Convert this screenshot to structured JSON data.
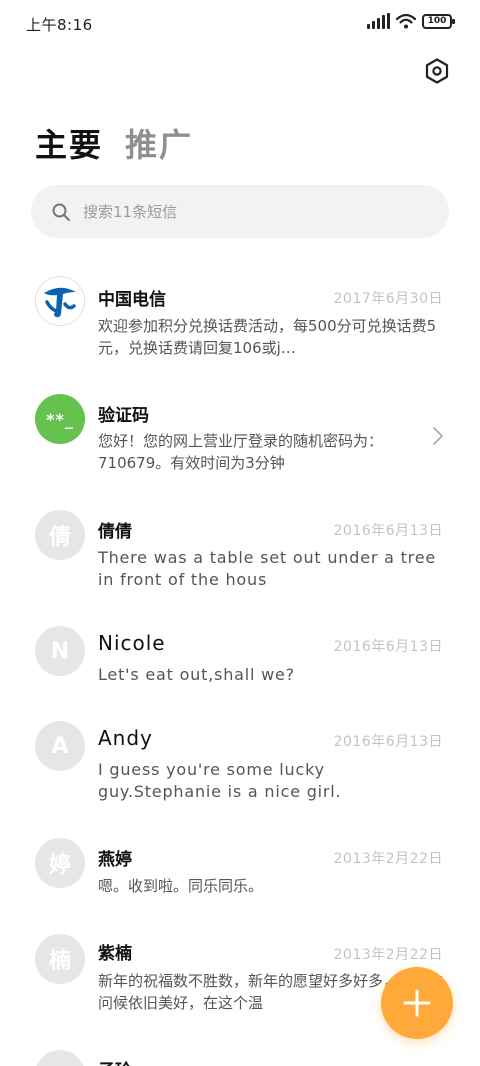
{
  "status_bar": {
    "time": "上午8:16",
    "battery": "100"
  },
  "tabs": {
    "primary": "主要",
    "secondary": "推广"
  },
  "search": {
    "placeholder": "搜索11条短信"
  },
  "messages": [
    {
      "avatar": "",
      "name": "中国电信",
      "date": "2017年6月30日",
      "preview": "欢迎参加积分兑换话费活动，每500分可兑换话费5元，兑换话费请回复106或j…"
    },
    {
      "avatar": "**_",
      "name": "验证码",
      "date": "",
      "preview": "您好！您的网上营业厅登录的随机密码为：710679。有效时间为3分钟"
    },
    {
      "avatar": "倩",
      "name": "倩倩",
      "date": "2016年6月13日",
      "preview": "There was a table set out under a tree in front of the hous"
    },
    {
      "avatar": "N",
      "name": "Nicole",
      "date": "2016年6月13日",
      "preview": "Let's eat out,shall we?"
    },
    {
      "avatar": "A",
      "name": "Andy",
      "date": "2016年6月13日",
      "preview": "I guess you're some lucky guy.Stephanie is a nice girl."
    },
    {
      "avatar": "婷",
      "name": "燕婷",
      "date": "2013年2月22日",
      "preview": "嗯。收到啦。同乐同乐。"
    },
    {
      "avatar": "楠",
      "name": "紫楠",
      "date": "2013年2月22日",
      "preview": "新年的祝福数不胜数，新年的愿望好多好多，新年的问候依旧美好，在这个温"
    },
    {
      "avatar": "",
      "name": "子玲",
      "date": "",
      "preview": ""
    }
  ],
  "colors": {
    "accent": "#ffa93a",
    "code_avatar": "#66c24e",
    "telecom_blue": "#0b64b0"
  }
}
